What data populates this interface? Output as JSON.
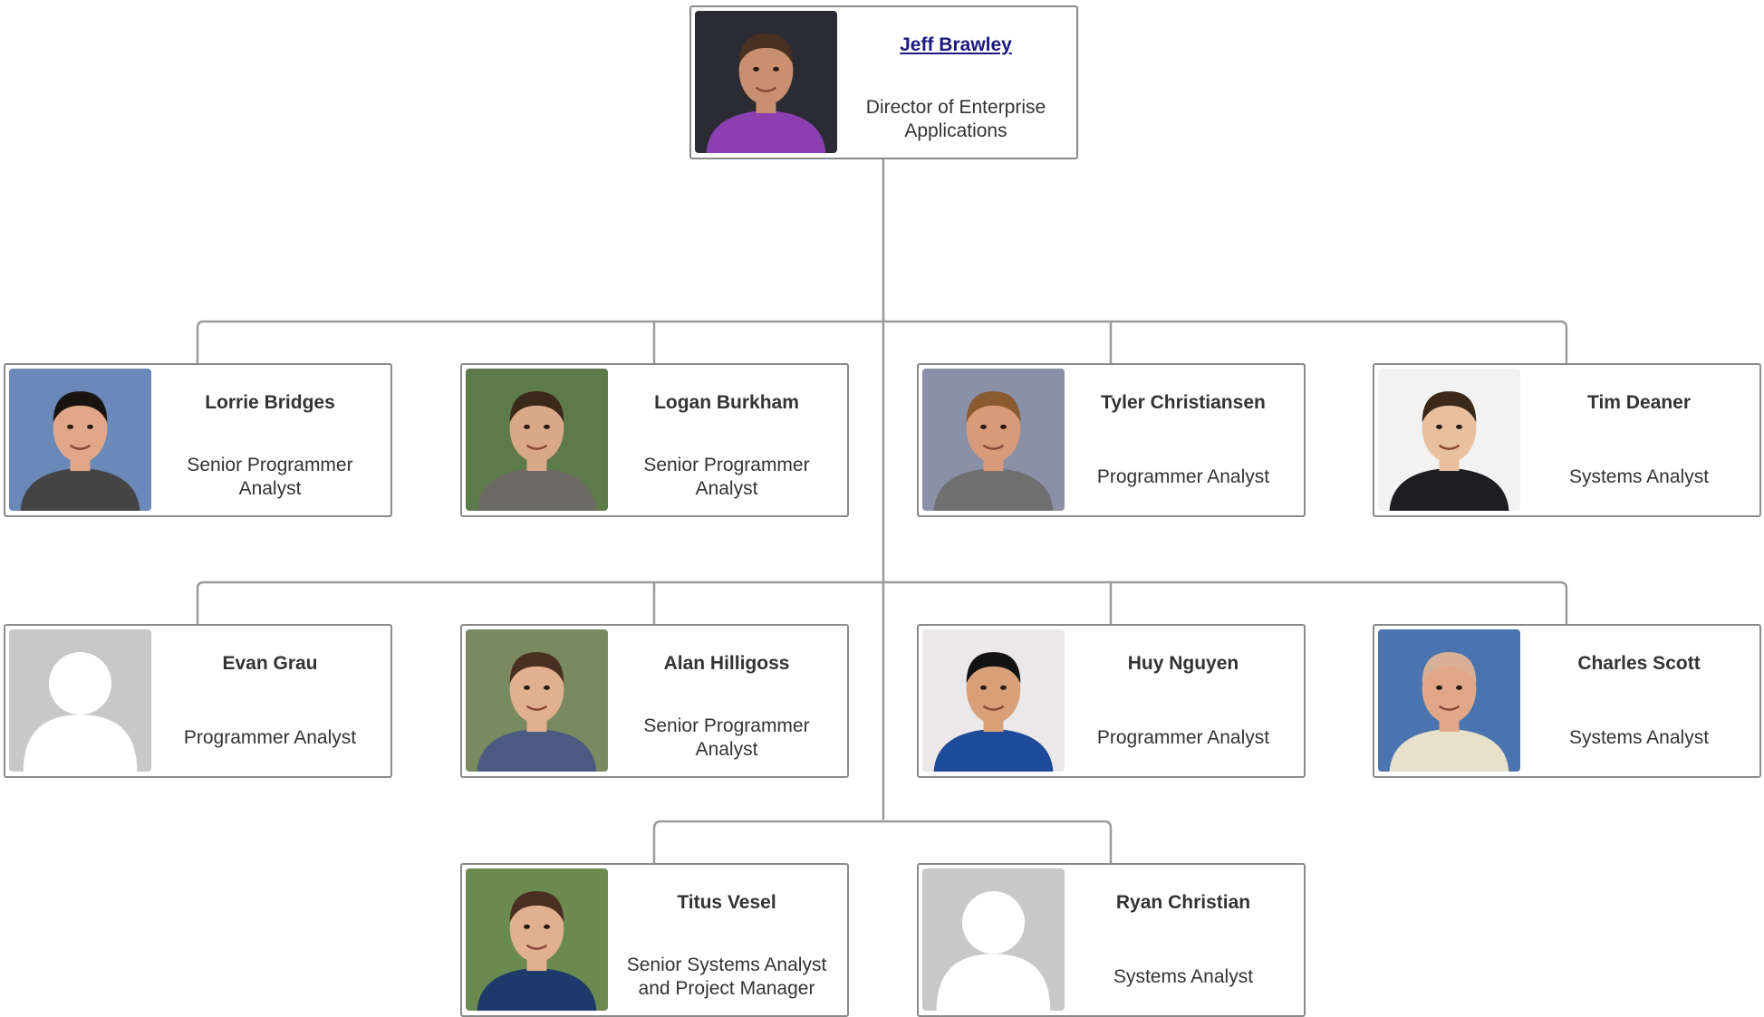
{
  "people": {
    "jeff": {
      "name": "Jeff Brawley",
      "title": "Director of Enterprise Applications",
      "photo": "person-photo",
      "shirt": "#8b3fb0",
      "bg": "#2b2b33",
      "skin": "#c89070",
      "hair": "#4a3020"
    },
    "lorrie": {
      "name": "Lorrie Bridges",
      "title": "Senior Programmer Analyst",
      "photo": "person-photo",
      "shirt": "#444444",
      "bg": "#6a88b8",
      "skin": "#e0a888",
      "hair": "#1a1410"
    },
    "logan": {
      "name": "Logan Burkham",
      "title": "Senior Programmer Analyst",
      "photo": "person-photo",
      "shirt": "#6a6a62",
      "bg": "#5d7a4a",
      "skin": "#d8a888",
      "hair": "#3a2818"
    },
    "tyler": {
      "name": "Tyler Christiansen",
      "title": "Programmer Analyst",
      "photo": "person-photo",
      "shirt": "#707070",
      "bg": "#8a90a8",
      "skin": "#d89a78",
      "hair": "#8a5a30"
    },
    "tim": {
      "name": "Tim Deaner",
      "title": "Systems Analyst",
      "photo": "person-photo",
      "shirt": "#1e1e22",
      "bg": "#f2f2f2",
      "skin": "#e8c0a0",
      "hair": "#3a2818"
    },
    "evan": {
      "name": "Evan Grau",
      "title": "Programmer Analyst",
      "photo": "placeholder-avatar"
    },
    "alan": {
      "name": "Alan Hilligoss",
      "title": "Senior Programmer Analyst",
      "photo": "person-photo",
      "shirt": "#4a5a80",
      "bg": "#7a8a60",
      "skin": "#e0b090",
      "hair": "#4a3020"
    },
    "huy": {
      "name": "Huy Nguyen",
      "title": "Programmer Analyst",
      "photo": "person-photo",
      "shirt": "#1e4a9a",
      "bg": "#ece8ea",
      "skin": "#d8a078",
      "hair": "#121212"
    },
    "charles": {
      "name": "Charles Scott",
      "title": "Systems Analyst",
      "photo": "person-photo",
      "shirt": "#e8e0c8",
      "bg": "#4a74b0",
      "skin": "#e0a888",
      "hair": "#d8b098"
    },
    "titus": {
      "name": "Titus Vesel",
      "title": "Senior Systems Analyst and Project Manager",
      "photo": "person-photo",
      "shirt": "#1e3a6a",
      "bg": "#6a8a50",
      "skin": "#e0b090",
      "hair": "#4a3020"
    },
    "ryan": {
      "name": "Ryan Christian",
      "title": "Systems Analyst",
      "photo": "placeholder-avatar"
    }
  },
  "colors": {
    "line": "#9a9a9a",
    "border": "#8a8a8a",
    "placeholder_bg": "#c8c8c8",
    "placeholder_fg": "#ffffff",
    "link": "#1a1a80",
    "text": "#333333"
  }
}
